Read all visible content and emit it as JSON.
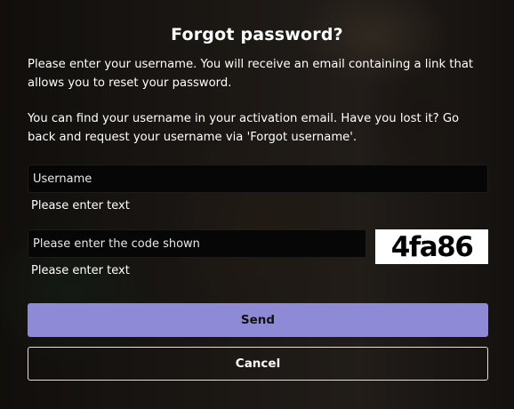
{
  "dialog": {
    "title": "Forgot password?",
    "paragraph_1": "Please enter your username. You will receive an email containing a link that allows you to reset your password.",
    "paragraph_2": "You can find your username in your activation email. Have you lost it? Go back and request your username via 'Forgot username'."
  },
  "form": {
    "username_placeholder": "Username",
    "username_hint": "Please enter text",
    "code_placeholder": "Please enter the code shown",
    "code_hint": "Please enter text",
    "captcha_text": "4fa86"
  },
  "buttons": {
    "send_label": "Send",
    "cancel_label": "Cancel"
  },
  "colors": {
    "send_button": "#8f8ad6",
    "input_background": "#060606"
  }
}
